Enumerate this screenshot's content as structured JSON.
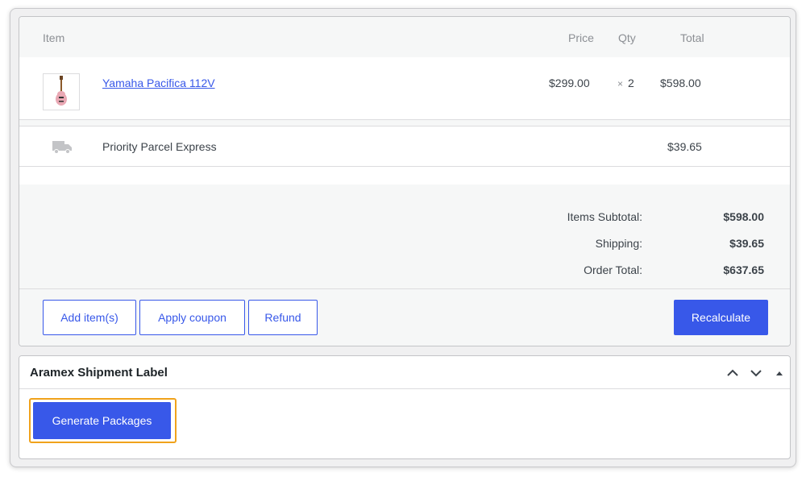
{
  "table": {
    "headers": {
      "item": "Item",
      "price": "Price",
      "qty": "Qty",
      "total": "Total"
    },
    "line_item": {
      "name": "Yamaha Pacifica 112V",
      "price": "$299.00",
      "qty_prefix": "×",
      "qty": "2",
      "total": "$598.00"
    },
    "shipping_line": {
      "name": "Priority Parcel Express",
      "total": "$39.65"
    }
  },
  "totals": {
    "subtotal_label": "Items Subtotal:",
    "subtotal_value": "$598.00",
    "shipping_label": "Shipping:",
    "shipping_value": "$39.65",
    "order_total_label": "Order Total:",
    "order_total_value": "$637.65"
  },
  "actions": {
    "add_items": "Add item(s)",
    "apply_coupon": "Apply coupon",
    "refund": "Refund",
    "recalculate": "Recalculate"
  },
  "shipment_panel": {
    "title": "Aramex Shipment Label",
    "generate_button": "Generate Packages"
  },
  "colors": {
    "accent": "#3858e9",
    "highlight": "#f0a21b",
    "header_bg": "#f6f7f7",
    "border": "#dcdcde"
  },
  "icons": {
    "product_thumbnail": "guitar-thumbnail",
    "shipping": "truck-icon",
    "move_up": "chevron-up-icon",
    "move_down": "chevron-down-icon",
    "toggle": "caret-up-icon"
  }
}
